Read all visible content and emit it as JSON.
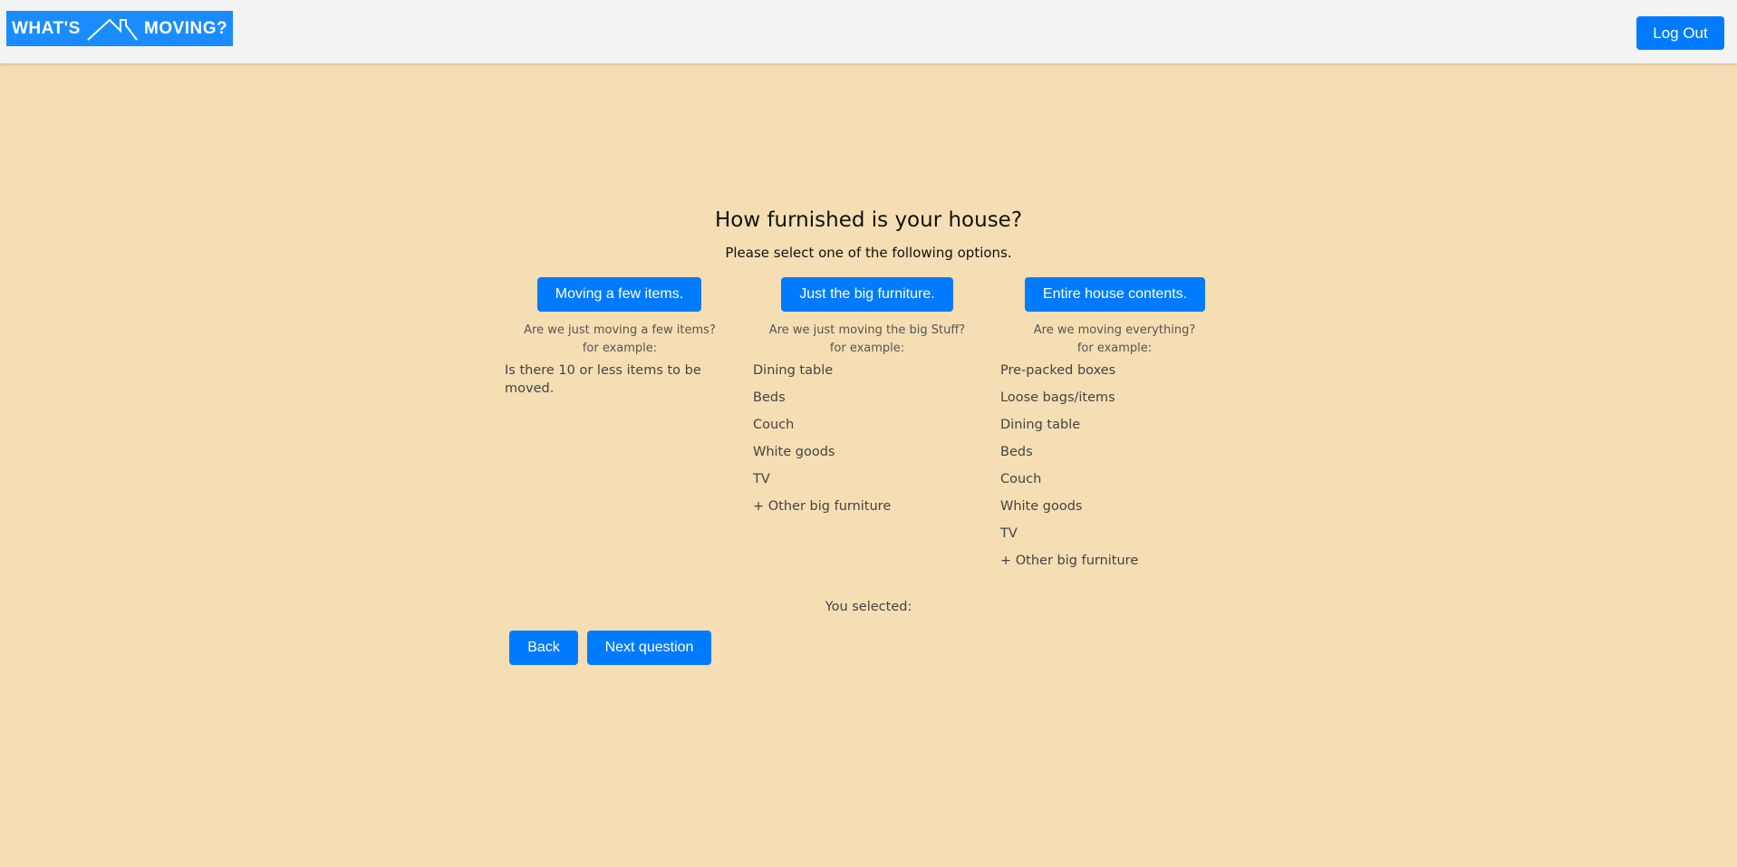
{
  "header": {
    "logo_left": "WHAT'S",
    "logo_right": "MOVING?",
    "logout_label": "Log Out"
  },
  "main": {
    "title": "How furnished is your house?",
    "subtitle": "Please select one of the following options.",
    "options": [
      {
        "label": "Moving a few items.",
        "question": "Are we just moving a few items?",
        "example_label": "for example:",
        "description": "Is there 10 or less items to be moved."
      },
      {
        "label": "Just the big furniture.",
        "question": "Are we just moving the big Stuff?",
        "example_label": "for example:",
        "items": [
          "Dining table",
          "Beds",
          "Couch",
          "White goods",
          "TV",
          "+ Other big furniture"
        ]
      },
      {
        "label": "Entire house contents.",
        "question": "Are we moving everything?",
        "example_label": "for example:",
        "items": [
          "Pre-packed boxes",
          "Loose bags/items",
          "Dining table",
          "Beds",
          "Couch",
          "White goods",
          "TV",
          "+ Other big furniture"
        ]
      }
    ],
    "selected_label": "You selected:",
    "back_label": "Back",
    "next_label": "Next question"
  },
  "colors": {
    "background": "#f5deb3",
    "header": "#f3f3f3",
    "accent": "#007bff",
    "logo": "#1a8cff"
  },
  "icons": {
    "logo_roof": "house-roof-icon"
  }
}
